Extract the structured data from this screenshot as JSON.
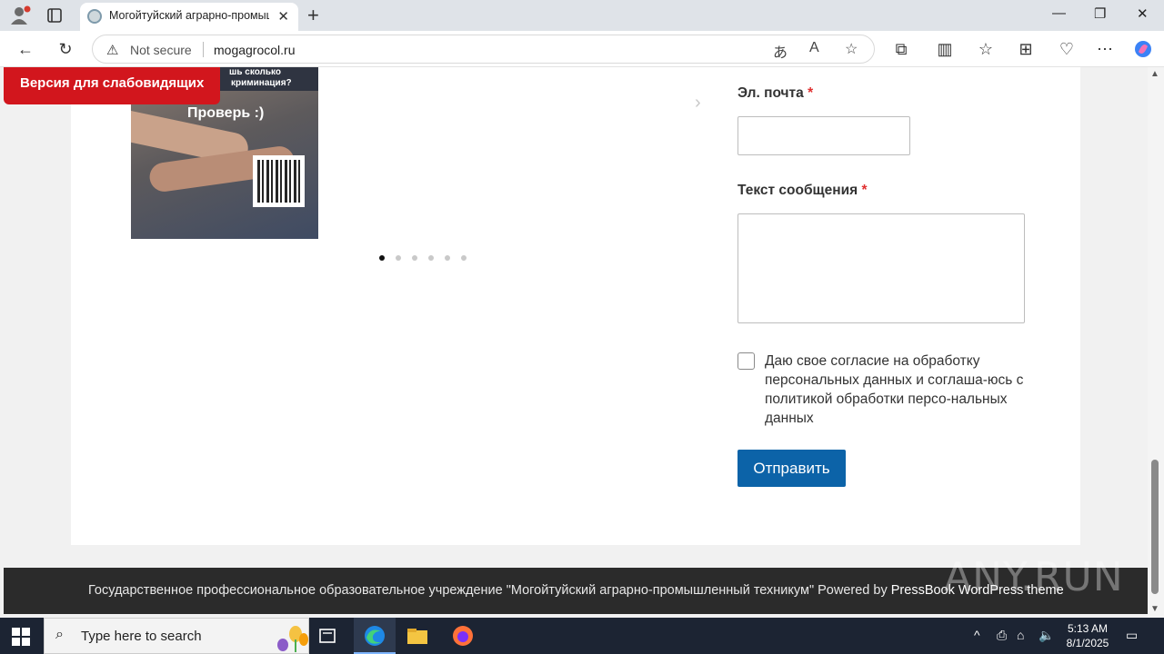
{
  "browser": {
    "tab_title": "Могойтуйский аграрно-промышленный техникум",
    "close_tab": "✕",
    "new_tab": "+",
    "security_label": "Not secure",
    "url": "mogagrocol.ru"
  },
  "page": {
    "accessibility_button": "Версия для слабовидящих",
    "slide": {
      "line1": "шь сколько",
      "line2": "криминация?",
      "headline": "Проверь :)"
    },
    "slider_dot_count": 6,
    "slider_active_dot": 1,
    "form": {
      "email_label": "Эл. почта",
      "message_label": "Текст сообщения",
      "required_mark": "*",
      "consent_text": "Даю свое согласие на обработку персональных данных и соглаша-юсь с политикой обработки персо-нальных данных",
      "submit_label": "Отправить"
    },
    "footer": {
      "text": "Государственное профессиональное образовательное учреждение \"Могойтуйский аграрно-промышленный техникум\" Powered by ",
      "link": "PressBook WordPress theme"
    },
    "watermark": "ANY.RUN"
  },
  "taskbar": {
    "search_placeholder": "Type here to search",
    "time": "5:13 AM",
    "date": "8/1/2025"
  }
}
